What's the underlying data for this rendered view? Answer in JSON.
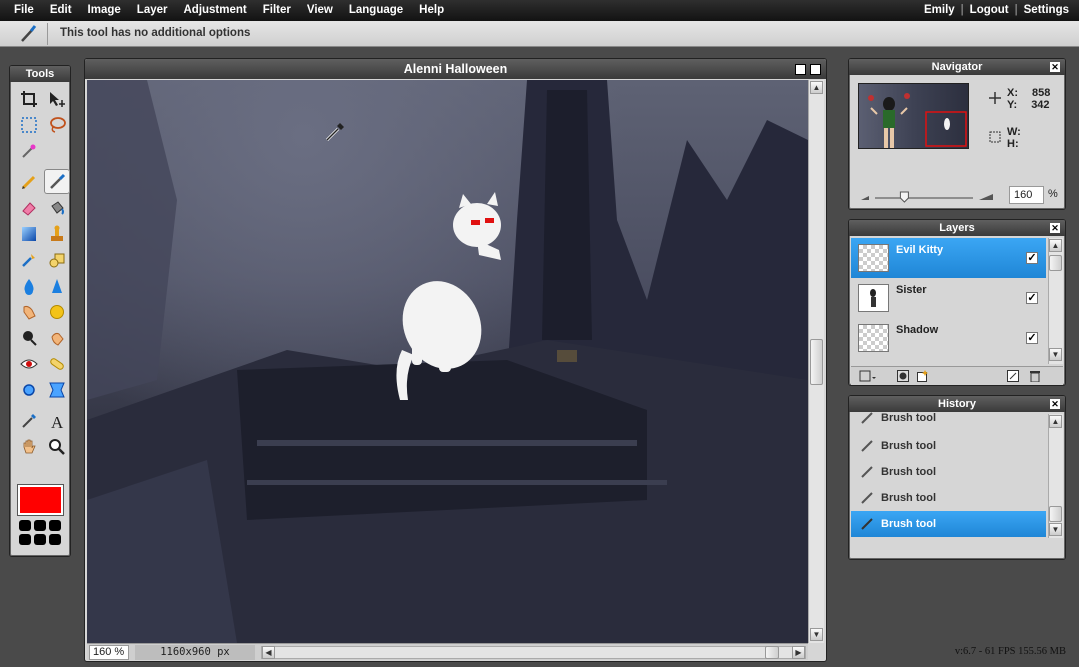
{
  "menu": {
    "items": [
      "File",
      "Edit",
      "Image",
      "Layer",
      "Adjustment",
      "Filter",
      "View",
      "Language",
      "Help"
    ],
    "user": "Emily",
    "logout": "Logout",
    "settings": "Settings",
    "separator": "|"
  },
  "options_bar": {
    "current_tool_icon": "brush-icon",
    "message": "This tool has no additional options"
  },
  "tools": {
    "title": "Tools",
    "items": [
      "crop-icon",
      "move-icon",
      "marquee-select-icon",
      "lasso-icon",
      "magic-wand-icon",
      "pencil-icon",
      "brush-icon",
      "eraser-icon",
      "paint-bucket-icon",
      "gradient-icon",
      "clone-stamp-icon",
      "color-replace-icon",
      "drawing-shape-icon",
      "blur-icon",
      "sharpen-icon",
      "smudge-icon",
      "sponge-icon",
      "dodge-icon",
      "burn-icon",
      "red-eye-icon",
      "spot-heal-icon",
      "bloat-icon",
      "pinch-icon",
      "color-picker-icon",
      "type-icon",
      "hand-icon",
      "zoom-icon"
    ],
    "active": "brush-icon",
    "foreground_color": "#ff0000"
  },
  "canvas": {
    "title": "Alenni Halloween",
    "zoom": "160",
    "zoom_unit": "%",
    "size": "1160x960 px"
  },
  "navigator": {
    "title": "Navigator",
    "x_label": "X:",
    "x_value": "858",
    "y_label": "Y:",
    "y_value": "342",
    "w_label": "W:",
    "h_label": "H:",
    "zoom": "160",
    "zoom_unit": "%",
    "zoom_level": 0.3
  },
  "layers": {
    "title": "Layers",
    "items": [
      {
        "name": "Evil Kitty",
        "visible": "✓",
        "selected": true
      },
      {
        "name": "Sister",
        "visible": "✓",
        "selected": false
      },
      {
        "name": "Shadow",
        "visible": "✓",
        "selected": false
      }
    ]
  },
  "history": {
    "title": "History",
    "items": [
      "Brush tool",
      "Brush tool",
      "Brush tool",
      "Brush tool",
      "Brush tool"
    ],
    "selected_index": 4
  },
  "status": {
    "version": "v:6.7 - 61 FPS 155.56 MB"
  },
  "colors": {
    "accent": "#2a95e8",
    "menubar": "#1e1e1e",
    "panel": "#d6d6d6"
  }
}
